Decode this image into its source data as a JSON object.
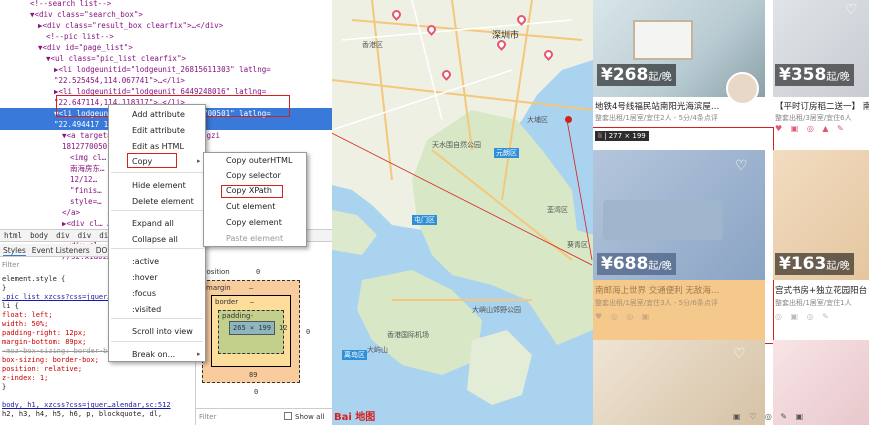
{
  "devtools": {
    "elements": [
      {
        "text": "<!--search list-->",
        "indent": 30,
        "cls": "c"
      },
      {
        "text": "▼<div class=\"search_box\">",
        "indent": 30
      },
      {
        "text": "▶<div class=\"result_box clearfix\">…</div>",
        "indent": 38
      },
      {
        "text": "<!--pic list-->",
        "indent": 46,
        "cls": "c"
      },
      {
        "text": "▼<div id=\"page_list\">",
        "indent": 38
      },
      {
        "text": "▼<ul class=\"pic_list clearfix\">",
        "indent": 46
      },
      {
        "text": "▶<li lodgeunitid=\"lodgeunit_26815611303\" latlng=",
        "indent": 54
      },
      {
        "text": "\"22.525454,114.067741\">…</li>",
        "indent": 54
      },
      {
        "text": "▶<li lodgeunitid=\"lodgeunit_6449248016\" latlng=",
        "indent": 54
      },
      {
        "text": "\"22.647114,114.118317\">…</li>",
        "indent": 54
      },
      {
        "text": "▼<li lodgeunitid=\"lodgeunit_18127700501\" latlng=",
        "indent": 54,
        "sel": true
      },
      {
        "text": "\"22.494417 11…",
        "indent": 54,
        "sel": true
      },
      {
        "text": "▼<a target=…  …sz.xiaozhu.com/fangzi",
        "indent": 62
      },
      {
        "text": "18127700501…  …_a\">",
        "indent": 62
      },
      {
        "text": "<img cl…  …z.xiaozhu.com/fangzi…",
        "indent": 70
      },
      {
        "text": "南海房东…  …邮 邻海上世界 交通便利 无",
        "indent": 70
      },
      {
        "text": "12/12…",
        "indent": 70
      },
      {
        "text": "\"finis…",
        "indent": 70
      },
      {
        "text": "style=…",
        "indent": 70
      },
      {
        "text": "</a>",
        "indent": 62
      },
      {
        "text": "▶<div cl…  …d.xiaozhu.com/",
        "indent": 62
      },
      {
        "text": "18127700…",
        "indent": 62
      },
      {
        "text": "▶<div cl…",
        "indent": 62
      },
      {
        "text": "//sz.xiaoz…",
        "indent": 62
      }
    ],
    "breadcrumbs": [
      "html",
      "body",
      "div",
      "div",
      "div"
    ],
    "style_tabs": [
      "Styles",
      "Event Listeners",
      "DOM"
    ],
    "filter_placeholder": "Filter",
    "css_lines": [
      {
        "t": "element.style {"
      },
      {
        "t": "}"
      },
      {
        "t": ".pic_list  xzcss?css=jquer…",
        "u": true
      },
      {
        "t": "li {"
      },
      {
        "t": "  float: left;",
        "p": true
      },
      {
        "t": "  width: 50%;",
        "p": true
      },
      {
        "t": "  padding-right: 12px;",
        "p": true
      },
      {
        "t": "  margin-bottom: 89px;",
        "p": true
      },
      {
        "t": "  -moz-box-sizing: border-box;",
        "strike": true
      },
      {
        "t": "  box-sizing: border-box;",
        "p": true
      },
      {
        "t": "  position: relative;",
        "p": true
      },
      {
        "t": "  z-index: 1;",
        "p": true
      },
      {
        "t": "}"
      },
      {
        "t": ""
      },
      {
        "t": "body, h1,   xzcss?css=jquer…alendar,sc:512",
        "u": true
      },
      {
        "t": "h2, h3, h4, h5, h6, p, blockquote, dl,"
      }
    ],
    "box_model": {
      "position_label": "position",
      "position_val": "0",
      "margin_label": "margin",
      "margin_val": "–",
      "margin_bottom": "89",
      "border_label": "border",
      "border_val": "–",
      "padding_label": "padding-",
      "padding_right": "12",
      "content": "265 × 199",
      "side_left": "0",
      "side_right": "0",
      "bottom_outer": "0"
    },
    "bottom_filter": "Filter",
    "show_all": "Show all"
  },
  "context_menu": {
    "items": [
      "Add attribute",
      "Edit attribute",
      "Edit as HTML",
      "Copy",
      "Hide element",
      "Delete element",
      "Expand all",
      "Collapse all",
      ":active",
      ":hover",
      ":focus",
      ":visited",
      "Scroll into view",
      "Break on..."
    ],
    "submenu": [
      "Copy outerHTML",
      "Copy selector",
      "Copy XPath",
      "Cut element",
      "Copy element",
      "Paste element"
    ]
  },
  "map": {
    "labels": [
      {
        "t": "深圳市",
        "cls": "city"
      },
      {
        "t": "香港区"
      },
      {
        "t": "元朗区",
        "badge": true
      },
      {
        "t": "屯门区",
        "badge": true
      },
      {
        "t": "大埔区"
      },
      {
        "t": "荃湾区"
      },
      {
        "t": "葵青区"
      },
      {
        "t": "香港国际机场"
      },
      {
        "t": "大屿山"
      },
      {
        "t": "离岛区",
        "badge": true
      },
      {
        "t": "天水围自然公园"
      },
      {
        "t": "大嶼山郊野公园"
      }
    ],
    "logo": "Bai 地图"
  },
  "listings": {
    "cards": [
      {
        "price": "¥268",
        "unit": "起/晚",
        "title": "地铁4号线福民站南阳光海滨屋…",
        "sub": "整套出租/1居室/宜住2人 - 5分/4条点评"
      },
      {
        "price": "¥358",
        "unit": "起/晚",
        "title": "【平时订房稻二送一】 南…",
        "sub": "整套出租/3居室/宜住6人"
      },
      {
        "price": "¥688",
        "unit": "起/晚",
        "title": "南邮海上世界 交通便利 无敌海…",
        "sub": "整套出租/1居室/宜住3人 - 5分/6条点评"
      },
      {
        "price": "¥163",
        "unit": "起/晚",
        "title": "宫式书房+独立花园阳台",
        "sub": "整套出租/1居室/宜住1人"
      }
    ],
    "tooltip_tag": "li",
    "tooltip_size": "277 × 199"
  },
  "colors": {
    "selection": "#3879d9",
    "highlight_red": "#d52020",
    "overlay_blue": "#7aa0d8",
    "overlay_orange": "#f5c98c"
  }
}
